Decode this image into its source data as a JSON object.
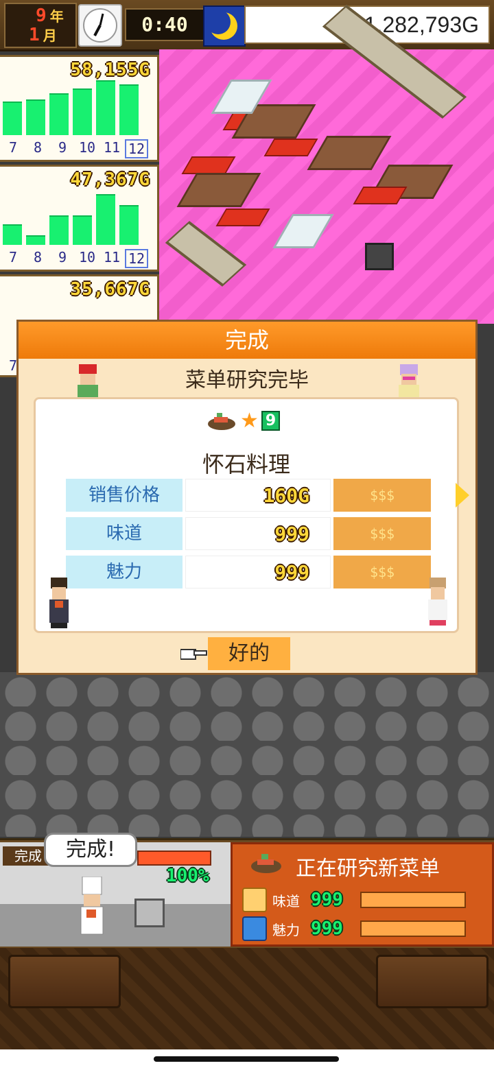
{
  "topbar": {
    "year": "9",
    "year_unit": "年",
    "month": "1",
    "month_unit": "月",
    "time": "0:40",
    "money": "1,282,793G"
  },
  "revenue_panels": [
    {
      "value": "58,155G",
      "months": [
        "7",
        "8",
        "9",
        "10",
        "11",
        "12"
      ],
      "bar_levels": [
        0.6,
        0.64,
        0.76,
        0.84,
        1.0,
        0.92
      ]
    },
    {
      "value": "47,367G",
      "months": [
        "7",
        "8",
        "9",
        "10",
        "11",
        "12"
      ],
      "bar_levels": [
        0.36,
        0.16,
        0.52,
        0.52,
        0.92,
        0.72
      ]
    },
    {
      "value": "35,667G",
      "months": [
        "7"
      ],
      "bar_levels": []
    }
  ],
  "dialog": {
    "header": "完成",
    "subtitle": "菜单研究完毕",
    "dish_level": "9",
    "dish_name": "怀石料理",
    "rows": [
      {
        "label": "销售价格",
        "value": "160G",
        "rating": "$$$"
      },
      {
        "label": "味道",
        "value": "999",
        "rating": "$$$"
      },
      {
        "label": "魅力",
        "value": "999",
        "rating": "$$$"
      }
    ],
    "ok": "好的"
  },
  "kitchen": {
    "tag": "完成",
    "bubble": "完成!",
    "progress_pct": "100%"
  },
  "research": {
    "title": "正在研究新菜单",
    "stats": [
      {
        "label": "味道",
        "value": "999",
        "level": 1.0
      },
      {
        "label": "魅力",
        "value": "999",
        "level": 1.0
      }
    ]
  },
  "colors": {
    "accent": "#ee7a0a",
    "floor": "#ff6ad9",
    "progress": "#18f070"
  }
}
